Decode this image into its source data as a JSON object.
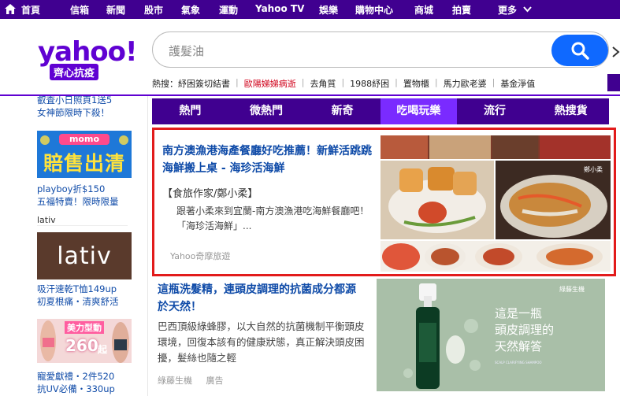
{
  "topnav": {
    "items": [
      "首頁",
      "信箱",
      "新聞",
      "股市",
      "氣象",
      "運動",
      "Yahoo TV",
      "娛樂",
      "購物中心",
      "商城",
      "拍賣",
      "更多"
    ]
  },
  "logo": {
    "brand": "yahoo!",
    "sub": "齊心抗疫"
  },
  "search": {
    "value": "護髮油"
  },
  "hot": {
    "label": "熱搜：",
    "items": [
      "紓困簽切結書",
      "歐陽娣娣病逝",
      "去角質",
      "1988紓困",
      "置物櫃",
      "馬力歐老婆",
      "基金淨值"
    ]
  },
  "left": {
    "promo1_text": [
      "叡査小日照頁1送5",
      "女神節限時下殺！"
    ],
    "momo_brand": "momo",
    "momo_title": "賠售出清",
    "promo2_text": [
      "playboy折$150",
      "五福特賣！限時限量"
    ],
    "lativ_label": "lativ",
    "lativ_logo": "lativ",
    "promo3_text": [
      "吸汗速乾T恤149up",
      "初夏根痛・清爽舒活"
    ],
    "promo3_badge_line1": "美力型動",
    "promo3_badge_price": "260",
    "promo3_badge_suffix": "起",
    "promo4_text": [
      "寵愛獻禮・2件520",
      "抗UV必備・330up"
    ]
  },
  "tabs": [
    "熱門",
    "微熱門",
    "新奇",
    "吃喝玩樂",
    "流行",
    "熱搜貨"
  ],
  "active_tab": "吃喝玩樂",
  "card": {
    "title": "南方澳漁港海產餐廳好吃推薦！新鮮活跳跳海鮮搬上桌 - 海珍活海鮮",
    "author": "【食旅作家/鄭小柔】",
    "desc": "跟著小柔來到宜蘭-南方澳漁港吃海鮮餐廳吧！「海珍活海鮮」...",
    "source": "Yahoo奇摩旅遊",
    "watermark": "鄭小柔"
  },
  "article2": {
    "title": "這瓶洗髮精，連頭皮調理的抗菌成分都源於天然！",
    "desc": "巴西頂級綠蜂膠，以大自然的抗菌機制平衡頭皮環境，回復本該有的健康狀態，真正解決頭皮困擾，髮絲也隨之輕",
    "meta_brand": "綠藤生機",
    "meta_ad": "廣告"
  },
  "ad": {
    "brand": "綠藤生機",
    "lines": [
      "這是一瓶",
      "頭皮調理的",
      "天然解答"
    ],
    "bottle_label": "SCALP CLARIFYING SHAMPOO"
  }
}
